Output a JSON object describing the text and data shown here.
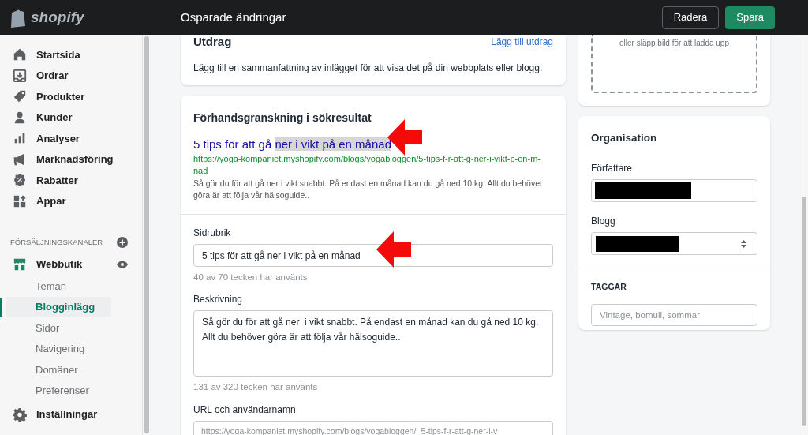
{
  "top_bar": {
    "brand": "shopify",
    "title": "Osparade ändringar",
    "buttons": [
      {
        "label": "Radera",
        "kind": "secondary"
      },
      {
        "label": "Spara",
        "kind": "primary"
      }
    ]
  },
  "sidebar": {
    "items": [
      {
        "label": "Startsida"
      },
      {
        "label": "Ordrar"
      },
      {
        "label": "Produkter"
      },
      {
        "label": "Kunder"
      },
      {
        "label": "Analyser"
      },
      {
        "label": "Marknadsföring"
      },
      {
        "label": "Rabatter"
      },
      {
        "label": "Appar"
      }
    ],
    "section_title": "FÖRSÄLJNINGSKANALER",
    "channel": {
      "label": "Webbutik",
      "children": [
        {
          "label": "Teman",
          "selected": false
        },
        {
          "label": "Blogginlägg",
          "selected": true
        },
        {
          "label": "Sidor",
          "selected": false
        },
        {
          "label": "Navigering",
          "selected": false
        },
        {
          "label": "Domäner",
          "selected": false
        },
        {
          "label": "Preferenser",
          "selected": false
        }
      ]
    },
    "settings": "Inställningar"
  },
  "excerpt_card": {
    "title": "Utdrag",
    "link": "Lägg till utdrag",
    "text": "Lägg till en sammanfattning av inlägget för att visa det på din webbplats eller blogg."
  },
  "seo_card": {
    "title": "Förhandsgranskning i sökresultat",
    "preview": {
      "title": "5 tips för att gå ",
      "title_highlighted": "ner i vikt på en månad",
      "url": "https://yoga-kompaniet.myshopify.com/blogs/yogabloggen/5-tips-f-r-att-g-ner-i-vikt-p-en-m-nad",
      "description": "Så gör du för att gå ner i vikt snabbt. På endast en månad kan du gå ned 10 kg. Allt du behöver göra är att följa vår hälsoguide.."
    },
    "fields": [
      {
        "label": "Sidrubrik",
        "kind": "input",
        "value": "5 tips för att gå ner i vikt på en månad",
        "hint": "40 av 70 tecken har använts"
      },
      {
        "label": "Beskrivning",
        "kind": "textarea",
        "value": "Så gör du för att gå ner  i vikt snabbt. På endast en månad kan du gå ned 10 kg. Allt du behöver göra är att följa vår hälsoguide..",
        "hint": "131 av 320 tecken har använts"
      },
      {
        "label": "URL och användarnamn",
        "kind": "url",
        "prefix": "https://yoga-kompaniet.myshopify.com/blogs/yogabloggen/",
        "value": "5-tips-f-r-att-g-ner-i-v"
      }
    ]
  },
  "image_card": {
    "drop_text": "eller släpp bild för att ladda upp"
  },
  "organisation_card": {
    "title": "Organisation",
    "author_label": "Författare",
    "blog_label": "Blogg",
    "tags_label": "TAGGAR",
    "tags_placeholder": "Vintage, bomull, sommar"
  }
}
